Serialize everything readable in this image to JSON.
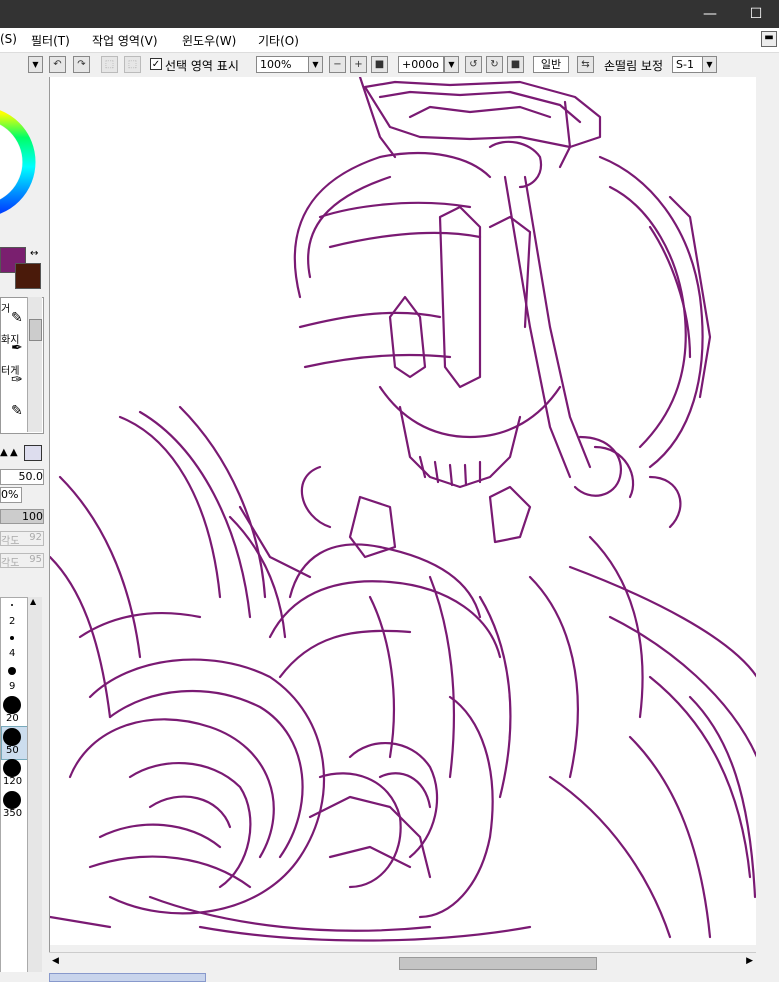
{
  "window": {
    "minimize_icon": "—",
    "maximize_icon": "☐"
  },
  "menu": {
    "items": [
      "(S)",
      "필터(T)",
      "작업 영역(V)",
      "윈도우(W)",
      "기타(O)"
    ],
    "close_glyph": "▬"
  },
  "toolbar": {
    "show_selection_label": "선택 영역 표시",
    "zoom_value": "100%",
    "rotation_value": "+000o",
    "mode_label": "일반",
    "stabilizer_label": "손떨림 보정",
    "stabilizer_value": "S-1"
  },
  "left_panel": {
    "tool_labels": [
      "거",
      "화지",
      "터게"
    ],
    "size_value": "50.0",
    "min_size": "0%",
    "density_value": "100",
    "opt1_label": "각도",
    "opt1_value": "92",
    "opt2_label": "각도",
    "opt2_value": "95",
    "brush_sizes": [
      "2",
      "4",
      "9",
      "20",
      "50",
      "120",
      "350"
    ],
    "selected_brush_size": "50"
  },
  "colors": {
    "main_color": "#7a1f6f",
    "sub_color": "#4a1a0a",
    "stroke": "#7a1a73"
  },
  "status": {
    "tab_label": "..."
  }
}
